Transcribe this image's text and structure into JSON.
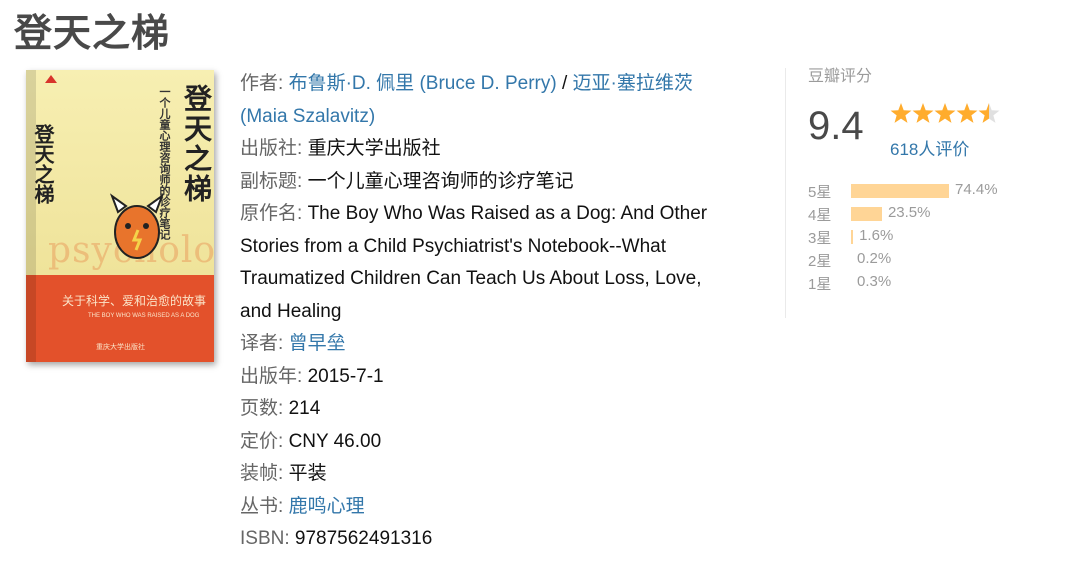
{
  "page_title": "登天之梯",
  "cover": {
    "vertical_title": "登天之梯",
    "vertical_subtitle": "一个儿童心理咨询师的诊疗笔记",
    "watermark": "psychological",
    "tagline": "关于科学、爱和治愈的故事",
    "english_title": "THE BOY WHO WAS RAISED AS A DOG",
    "publisher": "重庆大学出版社"
  },
  "info": {
    "author_label": "作者:",
    "author1": "布鲁斯·D. 佩里 (Bruce D. Perry)",
    "author_sep": " / ",
    "author2": "迈亚·塞拉维茨",
    "author2_en": "(Maia Szalavitz)",
    "publisher_label": "出版社:",
    "publisher": "重庆大学出版社",
    "subtitle_label": "副标题:",
    "subtitle": "一个儿童心理咨询师的诊疗笔记",
    "original_label": "原作名:",
    "original_lines": [
      "The Boy Who Was Raised as a Dog: And Other",
      "Stories from a Child Psychiatrist's Notebook--What",
      "Traumatized Children Can Teach Us About Loss, Love,",
      "and Healing"
    ],
    "translator_label": "译者:",
    "translator": "曾早垒",
    "pubyear_label": "出版年:",
    "pubyear": "2015-7-1",
    "pages_label": "页数:",
    "pages": "214",
    "price_label": "定价:",
    "price": "CNY 46.00",
    "binding_label": "装帧:",
    "binding": "平装",
    "series_label": "丛书:",
    "series": "鹿鸣心理",
    "isbn_label": "ISBN:",
    "isbn": "9787562491316"
  },
  "rating": {
    "header": "豆瓣评分",
    "score": "9.4",
    "stars": 4.5,
    "count": "618人评价",
    "distribution": [
      {
        "label": "5星",
        "pct": "74.4%",
        "value": 74.4
      },
      {
        "label": "4星",
        "pct": "23.5%",
        "value": 23.5
      },
      {
        "label": "3星",
        "pct": "1.6%",
        "value": 1.6
      },
      {
        "label": "2星",
        "pct": "0.2%",
        "value": 0.2
      },
      {
        "label": "1星",
        "pct": "0.3%",
        "value": 0.3
      }
    ]
  },
  "colors": {
    "link": "#3377aa",
    "bar": "#ffd596",
    "star": "#ffac2d"
  }
}
